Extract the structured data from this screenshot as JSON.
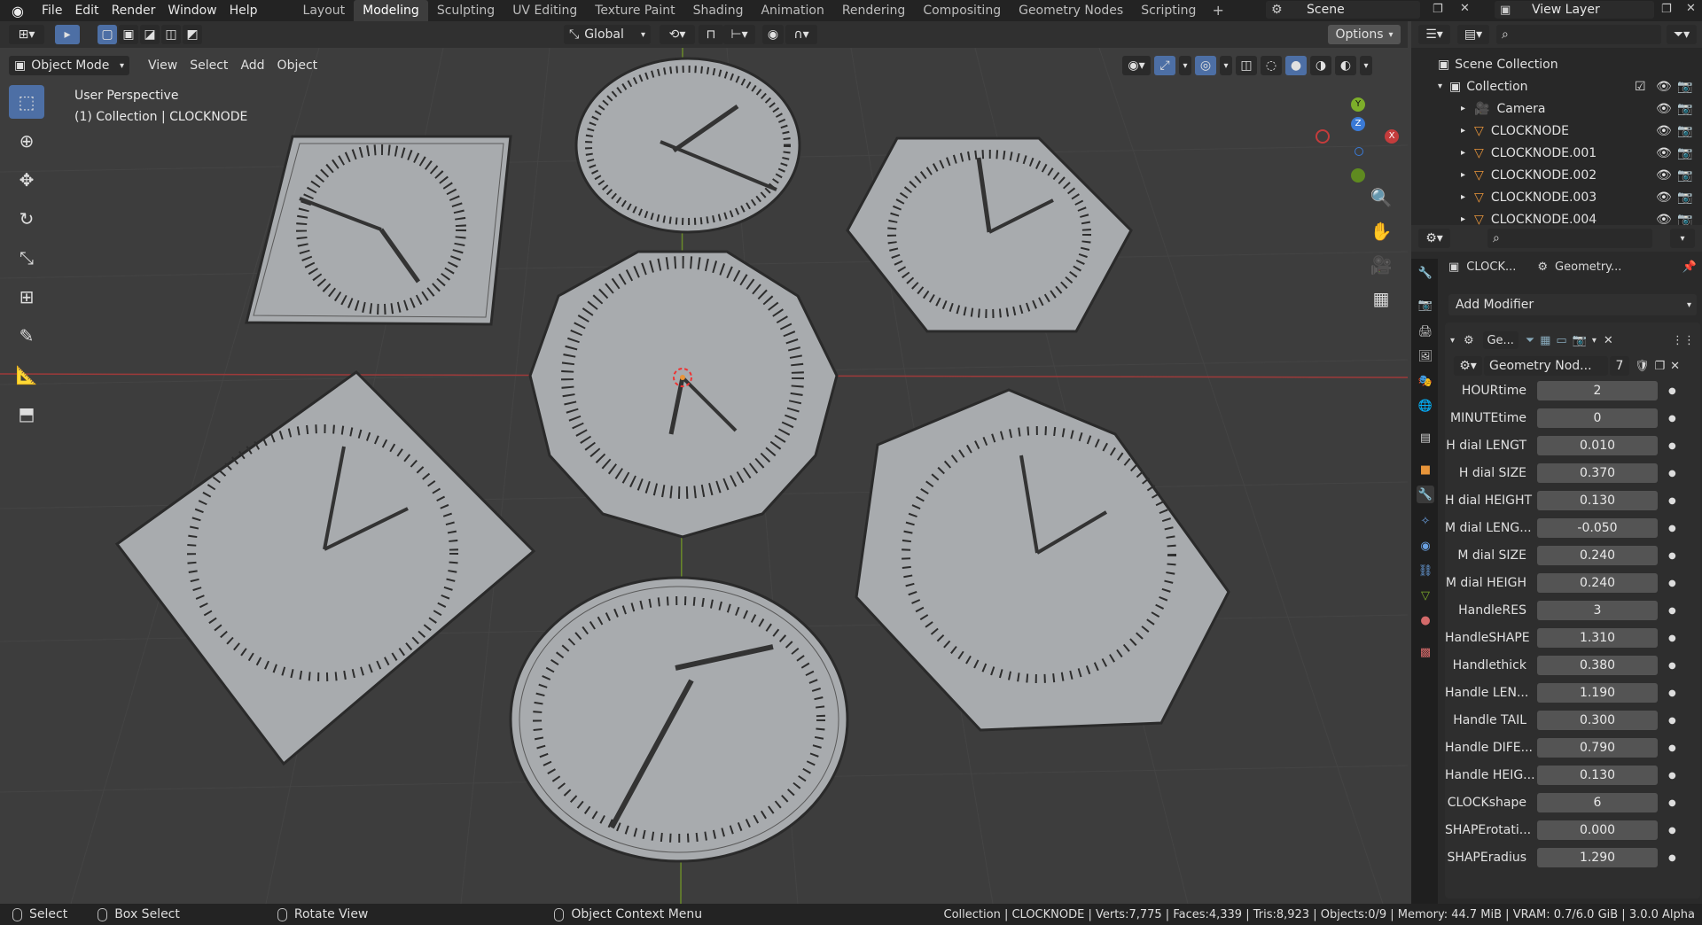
{
  "menu": {
    "file": "File",
    "edit": "Edit",
    "render": "Render",
    "window": "Window",
    "help": "Help"
  },
  "workspaces": [
    "Layout",
    "Modeling",
    "Sculpting",
    "UV Editing",
    "Texture Paint",
    "Shading",
    "Animation",
    "Rendering",
    "Compositing",
    "Geometry Nodes",
    "Scripting"
  ],
  "active_workspace": "Modeling",
  "scene": "Scene",
  "view_layer": "View Layer",
  "viewport": {
    "mode": "Object Mode",
    "menus": [
      "View",
      "Select",
      "Add",
      "Object"
    ],
    "transform_orientation": "Global",
    "options": "Options",
    "perspective": "User Perspective",
    "collection_info": "(1) Collection | CLOCKNODE"
  },
  "axes": {
    "y": "Y",
    "z": "Z",
    "x": "X"
  },
  "outliner": {
    "root": "Scene Collection",
    "collection": "Collection",
    "items": [
      "Camera",
      "CLOCKNODE",
      "CLOCKNODE.001",
      "CLOCKNODE.002",
      "CLOCKNODE.003",
      "CLOCKNODE.004"
    ]
  },
  "properties": {
    "object_name": "CLOCK...",
    "modifier_tab": "Geometry...",
    "add_modifier": "Add Modifier",
    "modifier_name": "Ge...",
    "node_group": "Geometry Nod...",
    "node_users": "7",
    "params": [
      {
        "label": "HOURtime",
        "value": "2"
      },
      {
        "label": "MINUTEtime",
        "value": "0"
      },
      {
        "label": "H dial LENGT",
        "value": "0.010"
      },
      {
        "label": "H dial SIZE",
        "value": "0.370"
      },
      {
        "label": "H dial HEIGHT",
        "value": "0.130"
      },
      {
        "label": "M dial LENG...",
        "value": "-0.050"
      },
      {
        "label": "M dial SIZE",
        "value": "0.240"
      },
      {
        "label": "M dial HEIGH",
        "value": "0.240"
      },
      {
        "label": "HandleRES",
        "value": "3"
      },
      {
        "label": "HandleSHAPE",
        "value": "1.310"
      },
      {
        "label": "Handlethick",
        "value": "0.380"
      },
      {
        "label": "Handle LEN...",
        "value": "1.190"
      },
      {
        "label": "Handle TAIL",
        "value": "0.300"
      },
      {
        "label": "Handle DIFE...",
        "value": "0.790"
      },
      {
        "label": "Handle HEIG...",
        "value": "0.130"
      },
      {
        "label": "CLOCKshape",
        "value": "6"
      },
      {
        "label": "SHAPErotati...",
        "value": "0.000"
      },
      {
        "label": "SHAPEradius",
        "value": "1.290"
      }
    ]
  },
  "statusbar": {
    "select": "Select",
    "box_select": "Box Select",
    "rotate": "Rotate View",
    "context": "Object Context Menu",
    "stats": "Collection | CLOCKNODE | Verts:7,775 | Faces:4,339 | Tris:8,923 | Objects:0/9 | Memory: 44.7 MiB | VRAM: 0.7/6.0 GiB | 3.0.0 Alpha"
  },
  "colors": {
    "accent": "#4d6fa5",
    "x_axis": "#c43c3c",
    "y_axis": "#7dae2a",
    "z_axis": "#3a7ad6",
    "object_orange": "#e8953a"
  }
}
